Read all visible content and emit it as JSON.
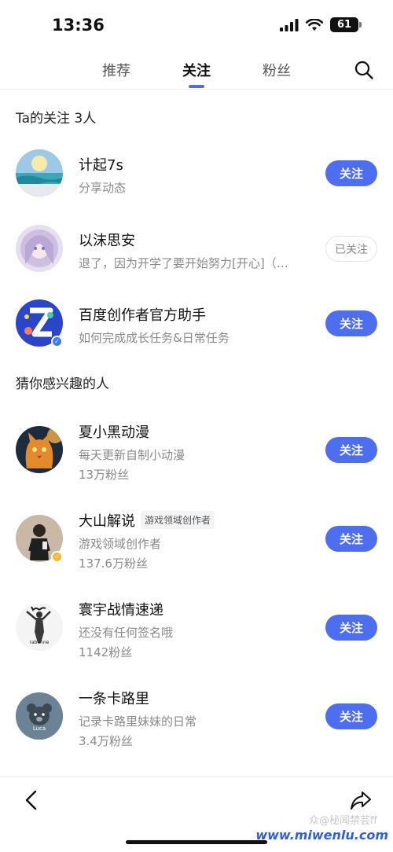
{
  "status_bar": {
    "time": "13:36",
    "battery": "61"
  },
  "tabs": [
    {
      "label": "推荐"
    },
    {
      "label": "关注"
    },
    {
      "label": "粉丝"
    }
  ],
  "following_section": {
    "title": "Ta的关注 3人"
  },
  "following": [
    {
      "name": "计起7s",
      "desc": "分享动态",
      "button": "关注"
    },
    {
      "name": "以沫思安",
      "desc": "退了，因为开学了要开始努力[开心]（…",
      "button": "已关注"
    },
    {
      "name": "百度创作者官方助手",
      "desc": "如何完成成长任务&日常任务",
      "button": "关注"
    }
  ],
  "suggest_section": {
    "title": "猜你感兴趣的人"
  },
  "suggestions": [
    {
      "name": "夏小黑动漫",
      "desc": "每天更新自制小动漫",
      "fans": "13万粉丝",
      "button": "关注"
    },
    {
      "name": "大山解说",
      "tag": "游戏领域创作者",
      "desc": "游戏领域创作者",
      "fans": "137.6万粉丝",
      "button": "关注"
    },
    {
      "name": "寰宇战情速递",
      "desc": "还没有任何签名哦",
      "fans": "1142粉丝",
      "button": "关注",
      "avatar_text": "rabanne"
    },
    {
      "name": "一条卡路里",
      "desc": "记录卡路里妹妹的日常",
      "fans": "3.4万粉丝",
      "button": "关注",
      "avatar_text": "Luca"
    }
  ],
  "watermark": {
    "main": "www.miwenlu.com",
    "sub": "众@秘闻禁芸ff"
  },
  "colors": {
    "accent": "#4e6ef2",
    "verify_blue": "#3a7bf5",
    "verify_gold": "#f5b82e"
  }
}
